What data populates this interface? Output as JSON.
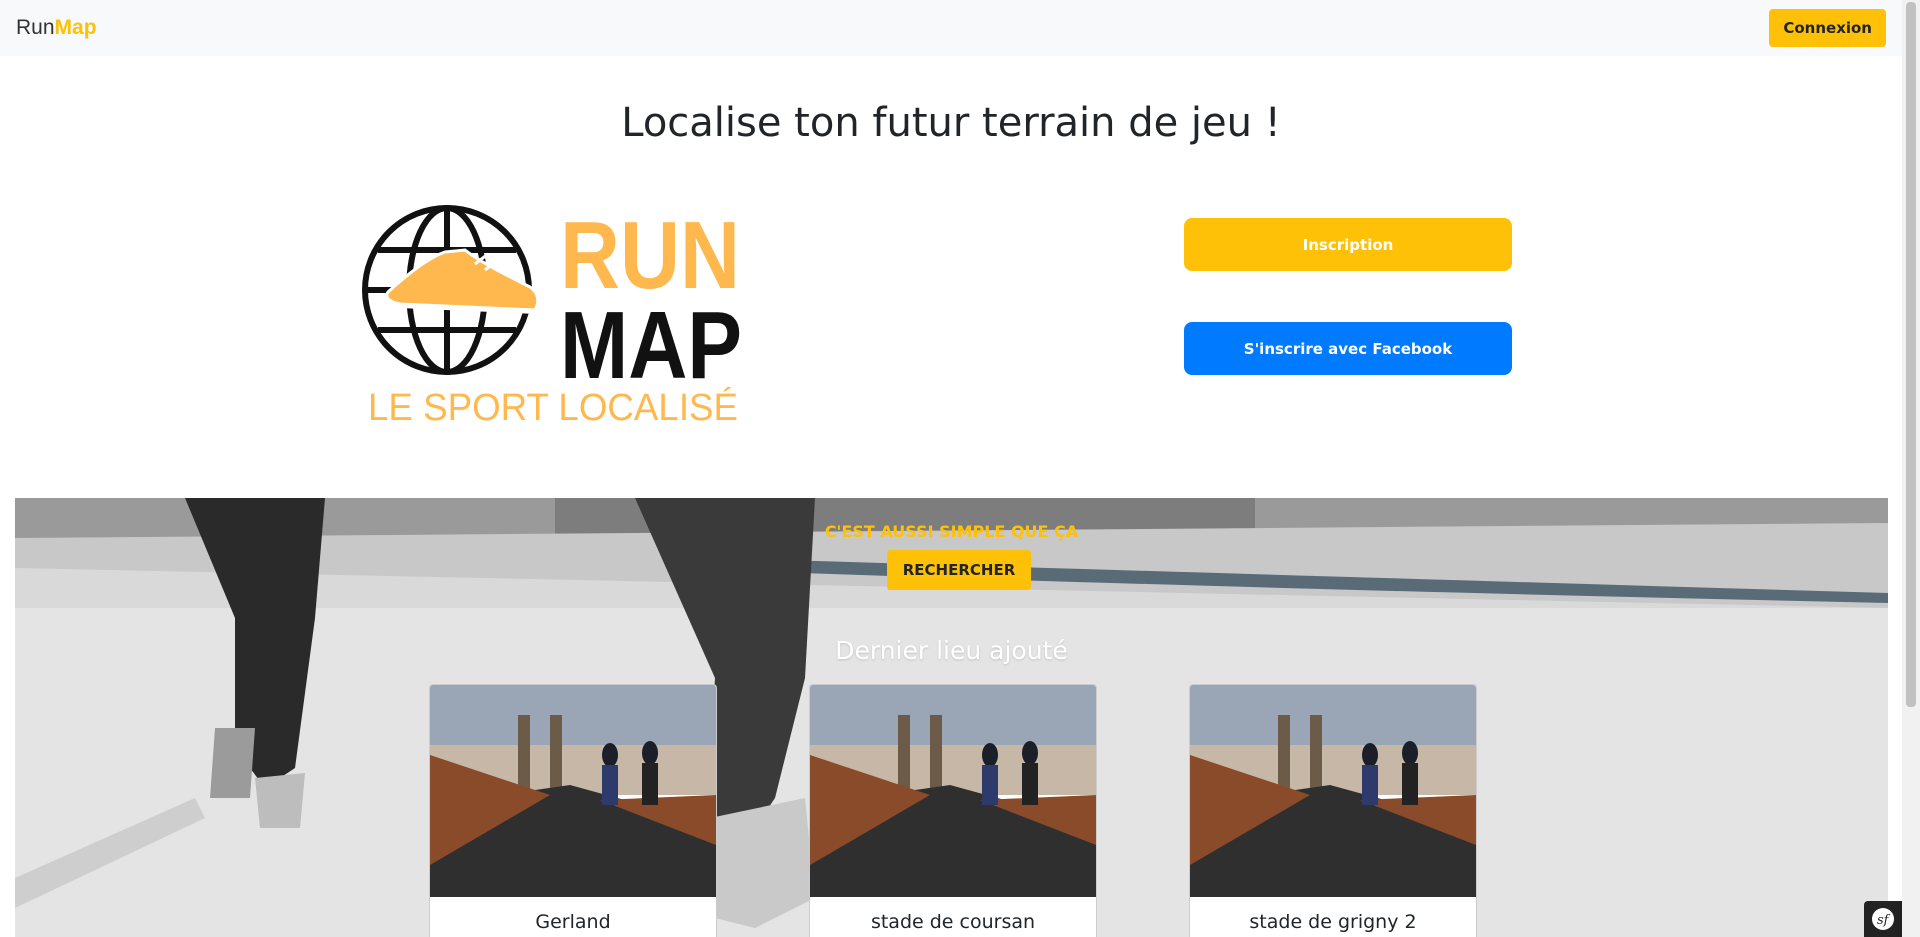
{
  "navbar": {
    "brand_prefix": "Run",
    "brand_accent": "Map",
    "login_label": "Connexion"
  },
  "hero": {
    "headline": "Localise ton futur terrain de jeu !",
    "logo": {
      "line1": "RUN",
      "line2": "MAP",
      "tagline": "LE SPORT LOCALISÉ"
    },
    "signup_label": "Inscription",
    "facebook_label": "S'inscrire avec Facebook"
  },
  "banner": {
    "tagline": "C'EST AUSSI SIMPLE QUE ÇA",
    "search_label": "RECHERCHER",
    "section_title": "Dernier lieu ajouté",
    "cards": [
      {
        "title": "Gerland"
      },
      {
        "title": "stade de coursan"
      },
      {
        "title": "stade de grigny 2"
      }
    ]
  },
  "colors": {
    "accent": "#ffc107",
    "facebook": "#007bff",
    "navbar_bg": "#f8f9fa",
    "logo_orange": "#ffb84d"
  },
  "icons": {
    "logo_globe": "globe-icon",
    "logo_shoe": "running-shoe-icon",
    "debug_toolbar": "symfony-icon"
  }
}
